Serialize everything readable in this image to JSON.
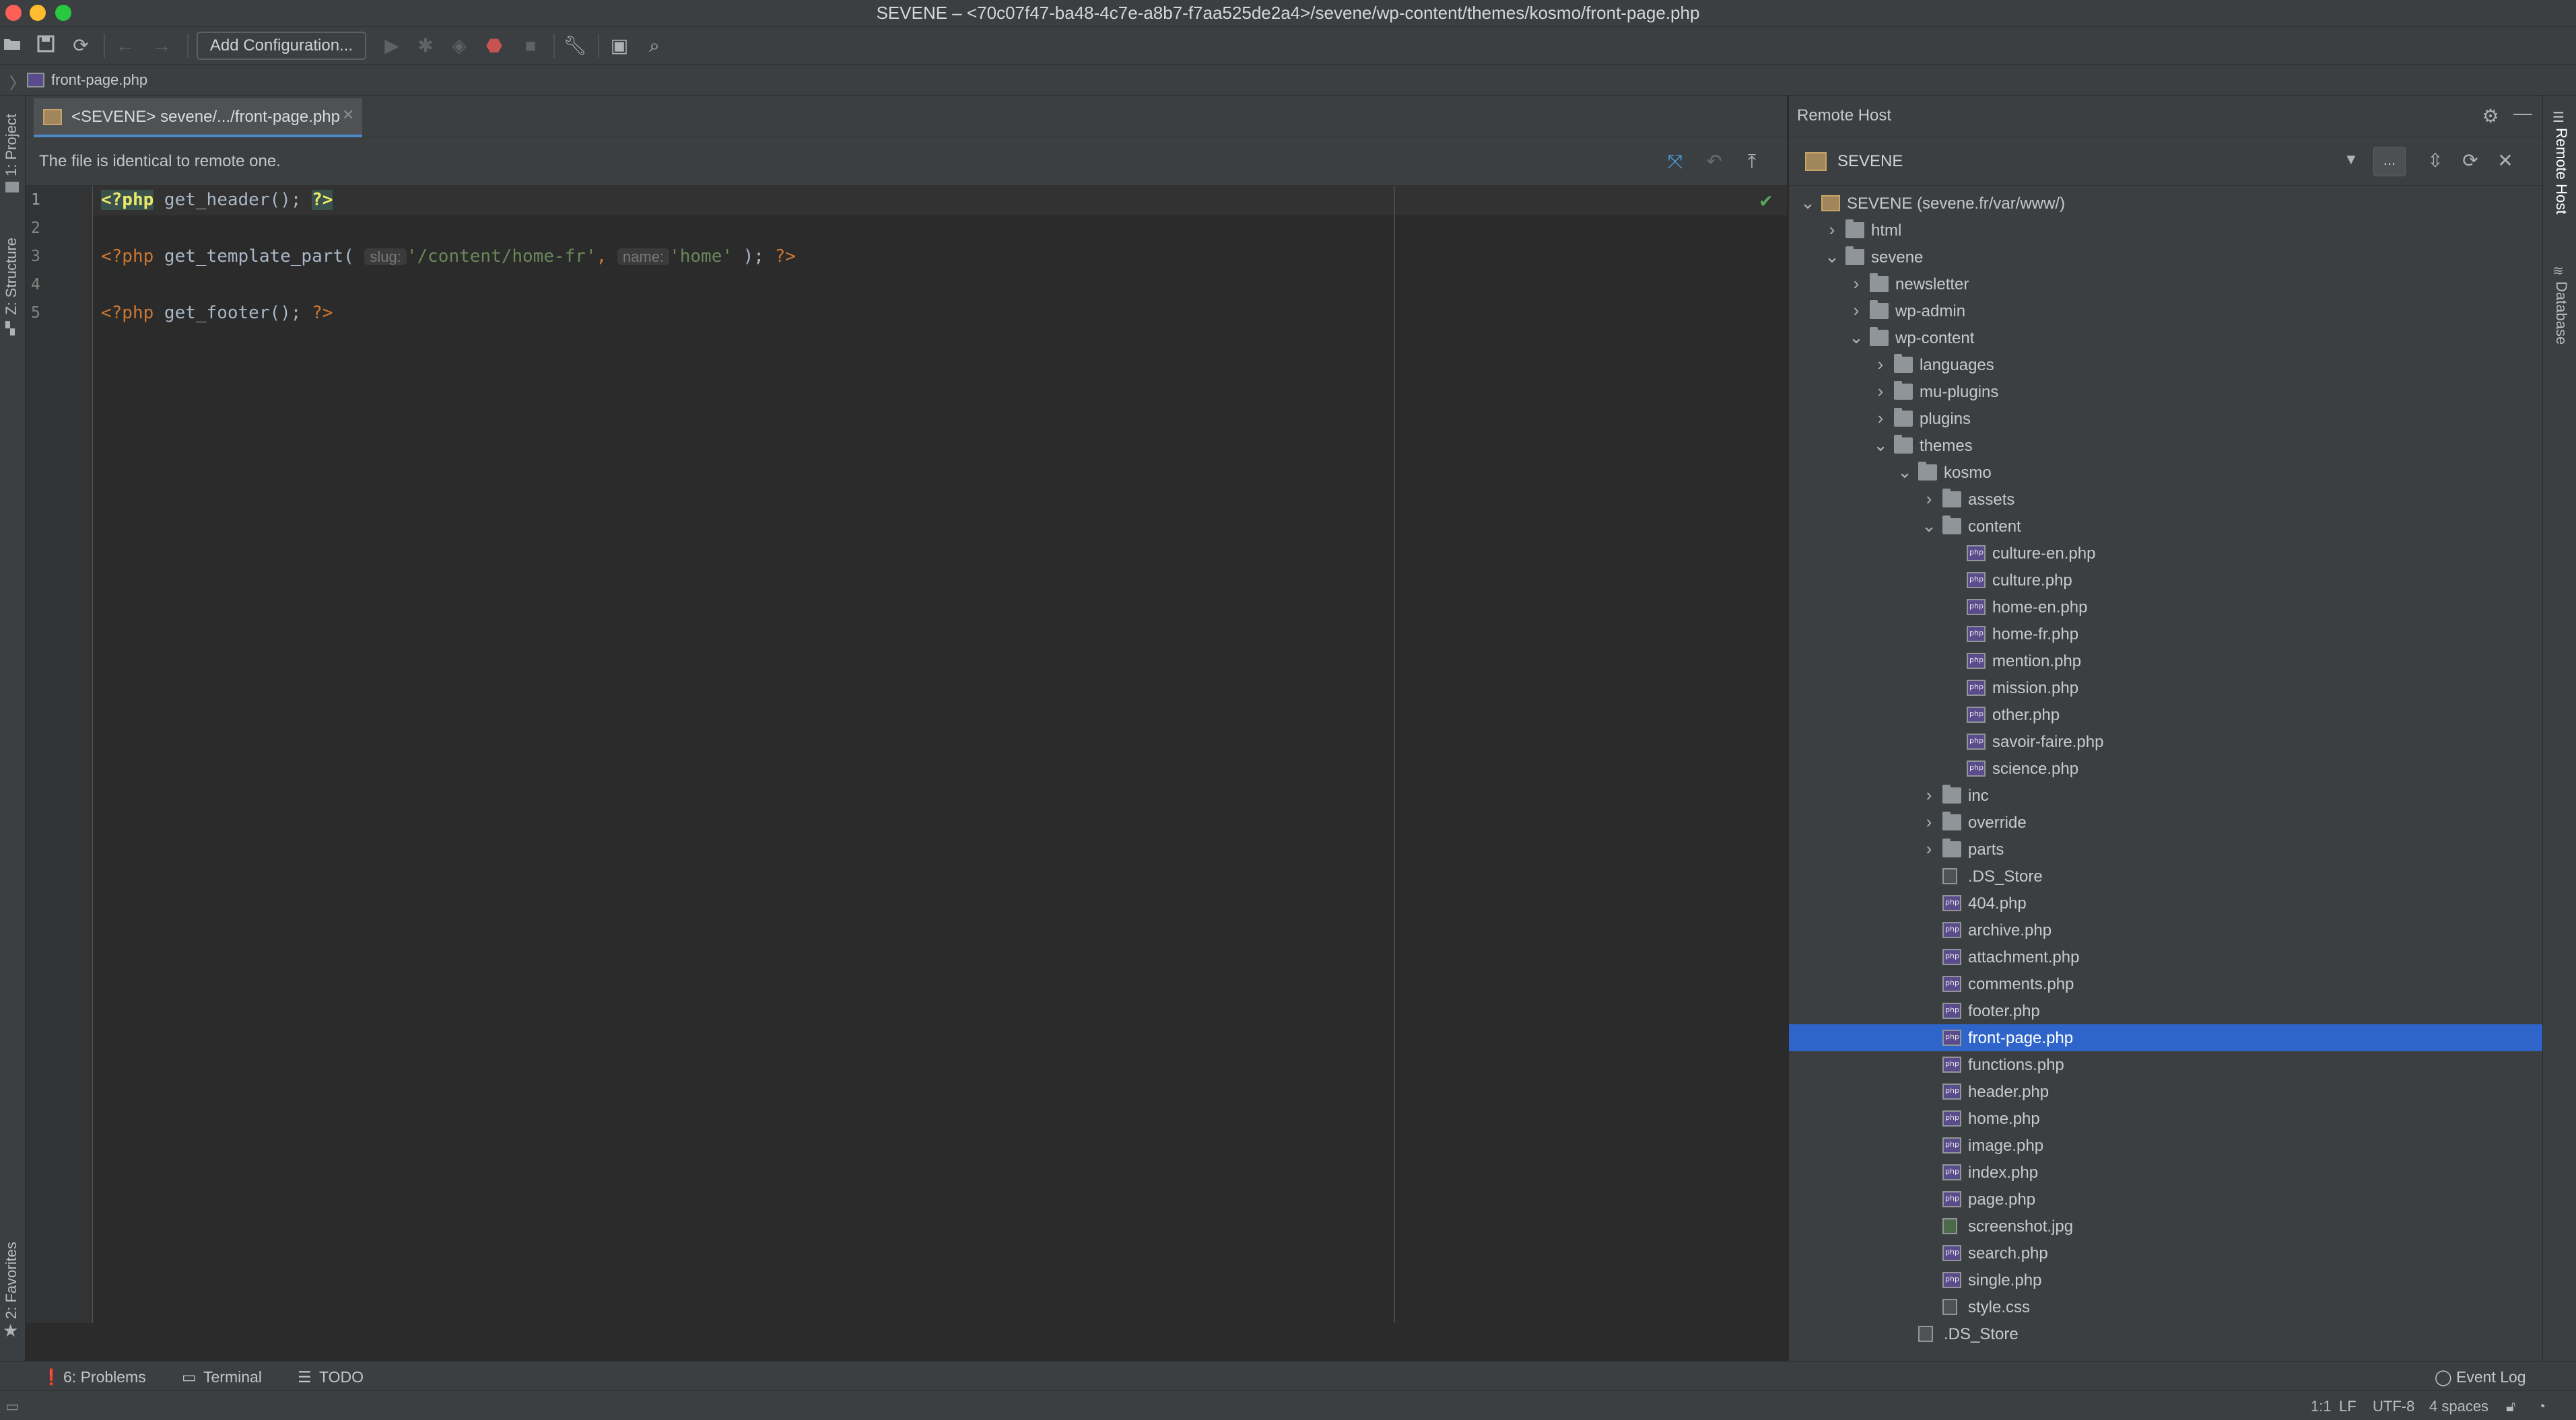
{
  "window": {
    "title": "SEVENE – <70c07f47-ba48-4c7e-a8b7-f7aa525de2a4>/sevene/wp-content/themes/kosmo/front-page.php",
    "traffic_colors": [
      "#fe5f57",
      "#febc2e",
      "#28c840"
    ]
  },
  "toolbar": {
    "add_configuration_label": "Add Configuration..."
  },
  "navbar": {
    "breadcrumb": "front-page.php"
  },
  "left_strip": {
    "project": "1: Project",
    "structure": "Z: Structure",
    "favorites": "2: Favorites"
  },
  "right_strip": {
    "remote_host": "Remote Host",
    "database": "Database"
  },
  "editor": {
    "tab_label": "<SEVENE> sevene/.../front-page.php",
    "banner": "The file is identical to remote one.",
    "line_numbers": [
      "1",
      "2",
      "3",
      "4",
      "5"
    ],
    "line1": {
      "open": "<?php",
      "call": " get_header(); ",
      "close": "?>"
    },
    "line3": {
      "open": "<?php",
      "call": " get_template_part( ",
      "hint_slug": "slug:",
      "str_slug": "'/content/home-fr'",
      "comma": ", ",
      "hint_name": "name:",
      "str_name": "'home'",
      "tail": " ); ",
      "close": "?>"
    },
    "line5": {
      "open": "<?php",
      "call": " get_footer(); ",
      "close": "?>"
    }
  },
  "remote_host": {
    "title": "Remote Host",
    "server": "SEVENE",
    "browse_label": "...",
    "tree": [
      {
        "label": "SEVENE (sevene.fr/var/www/)",
        "depth": 0,
        "type": "server",
        "state": "open"
      },
      {
        "label": "html",
        "depth": 1,
        "type": "folder",
        "state": "closed"
      },
      {
        "label": "sevene",
        "depth": 1,
        "type": "folder",
        "state": "open"
      },
      {
        "label": "newsletter",
        "depth": 2,
        "type": "folder",
        "state": "closed"
      },
      {
        "label": "wp-admin",
        "depth": 2,
        "type": "folder",
        "state": "closed"
      },
      {
        "label": "wp-content",
        "depth": 2,
        "type": "folder",
        "state": "open"
      },
      {
        "label": "languages",
        "depth": 3,
        "type": "folder",
        "state": "closed"
      },
      {
        "label": "mu-plugins",
        "depth": 3,
        "type": "folder",
        "state": "closed"
      },
      {
        "label": "plugins",
        "depth": 3,
        "type": "folder",
        "state": "closed"
      },
      {
        "label": "themes",
        "depth": 3,
        "type": "folder",
        "state": "open"
      },
      {
        "label": "kosmo",
        "depth": 4,
        "type": "folder",
        "state": "open"
      },
      {
        "label": "assets",
        "depth": 5,
        "type": "folder",
        "state": "closed"
      },
      {
        "label": "content",
        "depth": 5,
        "type": "folder",
        "state": "open"
      },
      {
        "label": "culture-en.php",
        "depth": 6,
        "type": "php"
      },
      {
        "label": "culture.php",
        "depth": 6,
        "type": "php"
      },
      {
        "label": "home-en.php",
        "depth": 6,
        "type": "php"
      },
      {
        "label": "home-fr.php",
        "depth": 6,
        "type": "php"
      },
      {
        "label": "mention.php",
        "depth": 6,
        "type": "php"
      },
      {
        "label": "mission.php",
        "depth": 6,
        "type": "php"
      },
      {
        "label": "other.php",
        "depth": 6,
        "type": "php"
      },
      {
        "label": "savoir-faire.php",
        "depth": 6,
        "type": "php"
      },
      {
        "label": "science.php",
        "depth": 6,
        "type": "php"
      },
      {
        "label": "inc",
        "depth": 5,
        "type": "folder",
        "state": "closed"
      },
      {
        "label": "override",
        "depth": 5,
        "type": "folder",
        "state": "closed"
      },
      {
        "label": "parts",
        "depth": 5,
        "type": "folder",
        "state": "closed"
      },
      {
        "label": ".DS_Store",
        "depth": 5,
        "type": "file"
      },
      {
        "label": "404.php",
        "depth": 5,
        "type": "php"
      },
      {
        "label": "archive.php",
        "depth": 5,
        "type": "php"
      },
      {
        "label": "attachment.php",
        "depth": 5,
        "type": "php"
      },
      {
        "label": "comments.php",
        "depth": 5,
        "type": "php"
      },
      {
        "label": "footer.php",
        "depth": 5,
        "type": "php"
      },
      {
        "label": "front-page.php",
        "depth": 5,
        "type": "php",
        "selected": true
      },
      {
        "label": "functions.php",
        "depth": 5,
        "type": "php"
      },
      {
        "label": "header.php",
        "depth": 5,
        "type": "php"
      },
      {
        "label": "home.php",
        "depth": 5,
        "type": "php"
      },
      {
        "label": "image.php",
        "depth": 5,
        "type": "php"
      },
      {
        "label": "index.php",
        "depth": 5,
        "type": "php"
      },
      {
        "label": "page.php",
        "depth": 5,
        "type": "php"
      },
      {
        "label": "screenshot.jpg",
        "depth": 5,
        "type": "image"
      },
      {
        "label": "search.php",
        "depth": 5,
        "type": "php"
      },
      {
        "label": "single.php",
        "depth": 5,
        "type": "php"
      },
      {
        "label": "style.css",
        "depth": 5,
        "type": "file"
      },
      {
        "label": ".DS_Store",
        "depth": 4,
        "type": "file"
      }
    ]
  },
  "bottom_bar": {
    "problems": "6: Problems",
    "terminal": "Terminal",
    "todo": "TODO",
    "event_log": "Event Log"
  },
  "status_bar": {
    "position": "1:1",
    "line_sep": "LF",
    "encoding": "UTF-8",
    "indent": "4 spaces"
  },
  "colors": {
    "selection": "#2f65ca",
    "keyword": "#cc7832",
    "string": "#6a8759",
    "php_tag_highlight": "#e8e868"
  }
}
